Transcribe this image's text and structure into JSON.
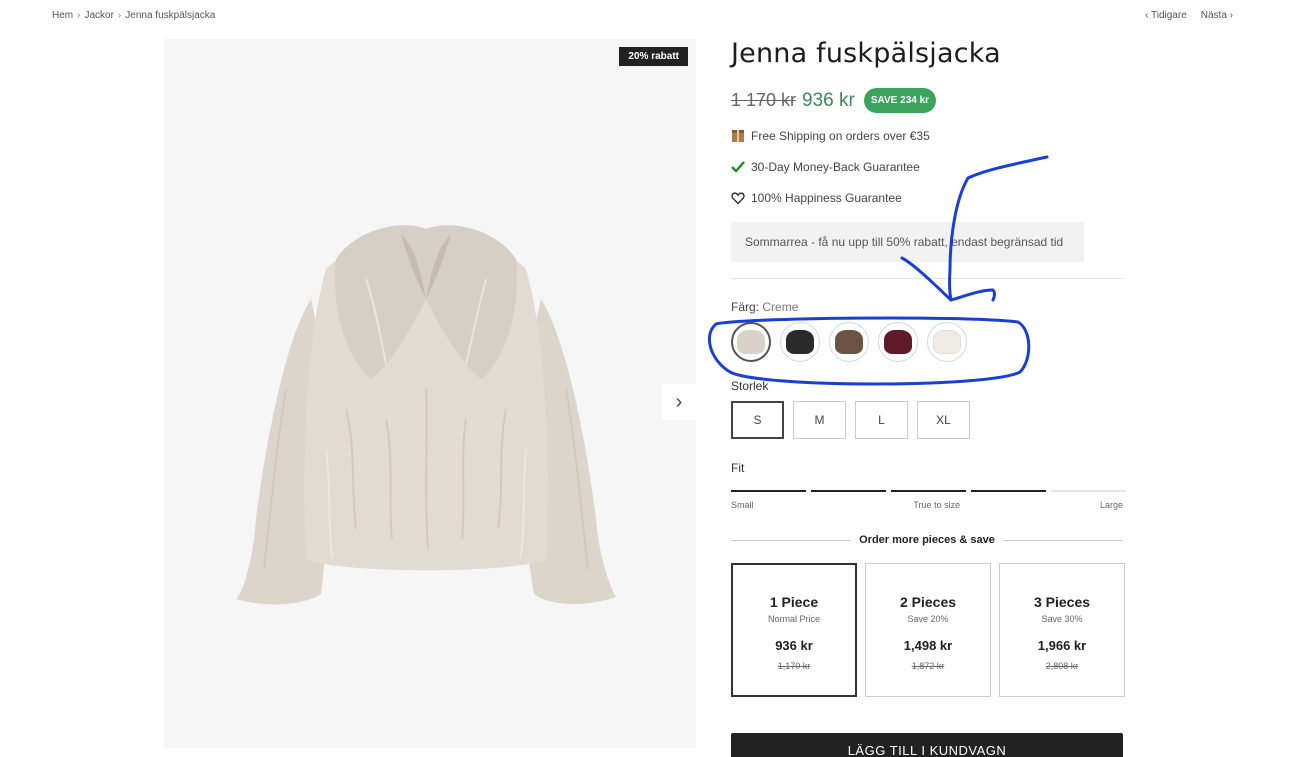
{
  "breadcrumb": {
    "items": [
      "Hem",
      "Jackor",
      "Jenna fuskpälsjacka"
    ],
    "separator": "›"
  },
  "pager": {
    "prev": "Tidigare",
    "next": "Nästa"
  },
  "gallery": {
    "badge": "20% rabatt",
    "next_icon": "chevron-right-icon"
  },
  "product": {
    "title": "Jenna fuskpälsjacka",
    "old_price": "1 170 kr",
    "price": "936 kr",
    "save_badge": "SAVE 234 kr"
  },
  "perks": [
    {
      "icon": "box-icon",
      "text": "Free Shipping on orders over €35"
    },
    {
      "icon": "check-icon",
      "text": "30-Day Money-Back Guarantee"
    },
    {
      "icon": "heart-icon",
      "text": "100% Happiness Guarantee"
    }
  ],
  "promo": "Sommarrea - få nu upp till 50% rabatt, endast begränsad tid",
  "color": {
    "label": "Färg:",
    "value": "Creme",
    "swatches": [
      {
        "name": "Creme",
        "hex": "#d9d2c8",
        "selected": true
      },
      {
        "name": "Svart",
        "hex": "#2a2a2a",
        "selected": false
      },
      {
        "name": "Brun",
        "hex": "#6b5443",
        "selected": false
      },
      {
        "name": "Vinröd",
        "hex": "#5e1a28",
        "selected": false
      },
      {
        "name": "Vit",
        "hex": "#efece6",
        "selected": false
      }
    ]
  },
  "size": {
    "label": "Storlek",
    "options": [
      "S",
      "M",
      "L",
      "XL"
    ],
    "selected": "S"
  },
  "fit": {
    "label": "Fit",
    "left": "Small",
    "middle": "True to size",
    "right": "Large",
    "filled_segments": 4,
    "total_segments": 5
  },
  "bundles": {
    "heading": "Order more pieces & save",
    "items": [
      {
        "title": "1 Piece",
        "subtitle": "Normal Price",
        "price": "936 kr",
        "old_price": "1,170 kr",
        "selected": true
      },
      {
        "title": "2 Pieces",
        "subtitle": "Save 20%",
        "price": "1,498 kr",
        "old_price": "1,872 kr",
        "selected": false
      },
      {
        "title": "3 Pieces",
        "subtitle": "Save 30%",
        "price": "1,966 kr",
        "old_price": "2,808 kr",
        "selected": false
      }
    ]
  },
  "cta": {
    "add_to_cart": "LÄGG TILL I KUNDVAGN"
  },
  "colors": {
    "accent_green": "#3aa35c",
    "price_green": "#3a8a5c",
    "annotation_blue": "#1a3fd6",
    "button_dark": "#222222"
  }
}
